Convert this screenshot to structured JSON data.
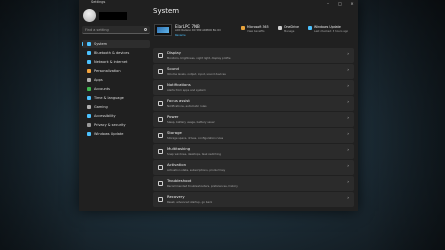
{
  "window": {
    "app_name": "Settings"
  },
  "sidebar": {
    "search_placeholder": "Find a setting",
    "items": [
      {
        "label": "System",
        "icon": "monitor-icon",
        "color": "#4cc2ff",
        "active": true
      },
      {
        "label": "Bluetooth & devices",
        "icon": "bluetooth-icon",
        "color": "#4cc2ff"
      },
      {
        "label": "Network & internet",
        "icon": "wifi-icon",
        "color": "#4cc2ff"
      },
      {
        "label": "Personalization",
        "icon": "brush-icon",
        "color": "#f3a33c"
      },
      {
        "label": "Apps",
        "icon": "apps-icon",
        "color": "#b0b0b0"
      },
      {
        "label": "Accounts",
        "icon": "person-icon",
        "color": "#3fb950"
      },
      {
        "label": "Time & language",
        "icon": "globe-clock-icon",
        "color": "#4cc2ff"
      },
      {
        "label": "Gaming",
        "icon": "gamepad-icon",
        "color": "#b0b0b0"
      },
      {
        "label": "Accessibility",
        "icon": "accessibility-icon",
        "color": "#4cc2ff"
      },
      {
        "label": "Privacy & security",
        "icon": "shield-icon",
        "color": "#9a9a9a"
      },
      {
        "label": "Windows Update",
        "icon": "update-icon",
        "color": "#4cc2ff"
      }
    ]
  },
  "main": {
    "title": "System",
    "device": {
      "name": "ElarLPC 7NB",
      "model": "AOC Radeon RX 580 ARMOR 8G OC",
      "rename": "Rename"
    },
    "tiles": [
      {
        "title": "Microsoft 365",
        "subtitle": "View benefits",
        "icon": "office-icon",
        "color": "#e8a33b"
      },
      {
        "title": "OneDrive",
        "subtitle": "Manage",
        "icon": "cloud-icon",
        "color": "#d0d0d0"
      },
      {
        "title": "Windows Update",
        "subtitle": "Last checked: 3 hours ago",
        "icon": "update-icon",
        "color": "#4cc2ff"
      }
    ],
    "settings": [
      {
        "title": "Display",
        "subtitle": "Monitors, brightness, night light, display profile",
        "icon": "display-icon"
      },
      {
        "title": "Sound",
        "subtitle": "Volume levels, output, input, sound devices",
        "icon": "speaker-icon"
      },
      {
        "title": "Notifications",
        "subtitle": "Alerts from apps and system",
        "icon": "bell-icon"
      },
      {
        "title": "Focus assist",
        "subtitle": "Notifications, automatic rules",
        "icon": "moon-icon"
      },
      {
        "title": "Power",
        "subtitle": "Sleep, battery usage, battery saver",
        "icon": "power-icon"
      },
      {
        "title": "Storage",
        "subtitle": "Storage space, drives, configuration rules",
        "icon": "storage-icon"
      },
      {
        "title": "Multitasking",
        "subtitle": "Snap windows, desktops, task switching",
        "icon": "multitask-icon"
      },
      {
        "title": "Activation",
        "subtitle": "Activation state, subscriptions, product key",
        "icon": "key-icon"
      },
      {
        "title": "Troubleshoot",
        "subtitle": "Recommended troubleshooters, preferences, history",
        "icon": "wrench-icon"
      },
      {
        "title": "Recovery",
        "subtitle": "Reset, advanced startup, go back",
        "icon": "recovery-icon"
      }
    ]
  }
}
